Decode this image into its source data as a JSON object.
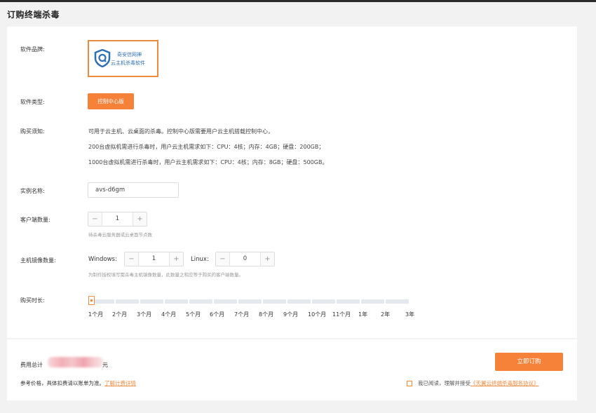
{
  "page_title": "订购终端杀毒",
  "brand": {
    "label": "软件品牌:",
    "logo_line1": "奇安信网神",
    "logo_line2": "云主机杀毒软件"
  },
  "software_type": {
    "label": "软件类型:",
    "option": "控制中心版"
  },
  "notice": {
    "label": "购买须知:",
    "lines": [
      "可用于云主机、云桌面的杀毒。控制中心版需要用户云主机搭载控制中心，",
      "200台虚拟机需进行杀毒时，用户云主机需求如下：CPU：4核；内存：4GB；硬盘：200GB；",
      "1000台虚拟机需进行杀毒时，用户云主机需求如下：CPU：4核；内存：8GB；硬盘：500GB。"
    ]
  },
  "instance": {
    "label": "实例名称:",
    "value": "avs-d6gm"
  },
  "clients": {
    "label": "客户端数量:",
    "value": "1",
    "hint": "待杀毒云服务器或云桌面节点数"
  },
  "images": {
    "label": "主机镜像数量:",
    "windows_label": "Windows:",
    "windows_value": "1",
    "linux_label": "Linux:",
    "linux_value": "0",
    "hint": "为制作授权填写需杀毒主机镜像数量，此数量之和应等于购买的客户端数量。"
  },
  "duration": {
    "label": "购买时长:",
    "ticks": [
      "1个月",
      "2个月",
      "3个月",
      "4个月",
      "5个月",
      "6个月",
      "7个月",
      "8个月",
      "9个月",
      "10个月",
      "11个月",
      "1年",
      "2年",
      "3年"
    ],
    "selected": "1个月",
    "selected_index": 0
  },
  "footer": {
    "fee_label": "费用总计",
    "currency": "元",
    "ref_text": "参考价格，具体扣费请以账单为准。",
    "ref_link": "了解计费详情",
    "order_button": "立即订购",
    "agree_text": "我已阅读，理解并接受",
    "agree_link": "《天翼云终端杀毒服务协议》"
  },
  "colors": {
    "accent": "#f6823a",
    "link": "#f08b3e",
    "logo_blue": "#2e70b6",
    "background": "#f2f2f2"
  },
  "icons": {
    "brand_logo": "shield-q-icon",
    "minus": "minus-icon",
    "plus": "plus-icon"
  }
}
